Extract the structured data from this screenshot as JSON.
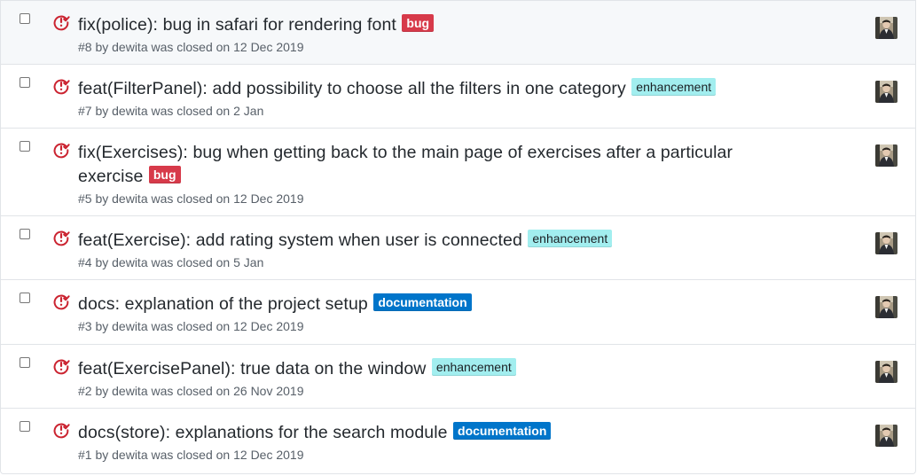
{
  "issues": [
    {
      "title": "fix(police): bug in safari for rendering font",
      "label": "bug",
      "label_type": "bug",
      "meta": "#8 by dewita was closed on 12 Dec 2019"
    },
    {
      "title": "feat(FilterPanel): add possibility to choose all the filters in one category",
      "label": "enhancement",
      "label_type": "enhancement",
      "meta": "#7 by dewita was closed on 2 Jan"
    },
    {
      "title": "fix(Exercises): bug when getting back to the main page of exercises after a particular exercise",
      "label": "bug",
      "label_type": "bug",
      "meta": "#5 by dewita was closed on 12 Dec 2019"
    },
    {
      "title": "feat(Exercise): add rating system when user is connected",
      "label": "enhancement",
      "label_type": "enhancement",
      "meta": "#4 by dewita was closed on 5 Jan"
    },
    {
      "title": "docs: explanation of the project setup",
      "label": "documentation",
      "label_type": "documentation",
      "meta": "#3 by dewita was closed on 12 Dec 2019"
    },
    {
      "title": "feat(ExercisePanel): true data on the window",
      "label": "enhancement",
      "label_type": "enhancement",
      "meta": "#2 by dewita was closed on 26 Nov 2019"
    },
    {
      "title": "docs(store): explanations for the search module",
      "label": "documentation",
      "label_type": "documentation",
      "meta": "#1 by dewita was closed on 12 Dec 2019"
    }
  ],
  "icons": {
    "state": "issue-closed-icon",
    "assignee": "avatar"
  },
  "colors": {
    "closed_icon": "#cb2431",
    "bug": "#d73a4a",
    "enhancement": "#a2eeef",
    "documentation": "#0075ca",
    "title_text": "#24292e",
    "meta_text": "#586069",
    "border": "#e1e4e8"
  }
}
